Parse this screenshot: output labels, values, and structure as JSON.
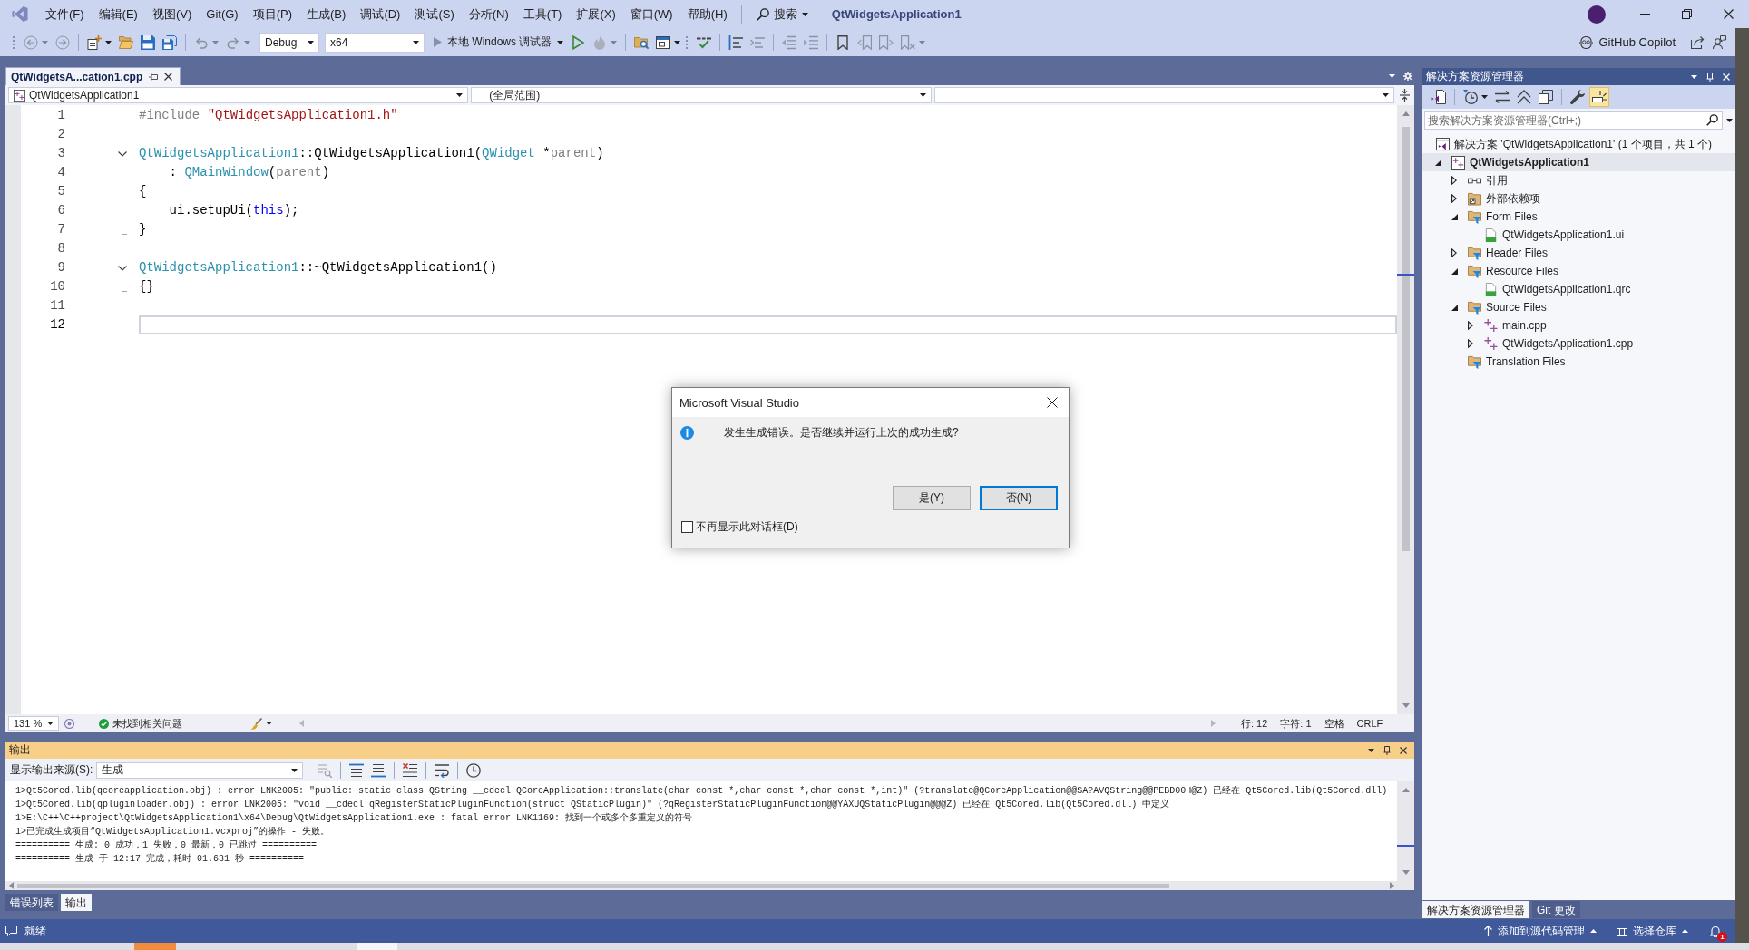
{
  "title_bar": {
    "menu": [
      "文件(F)",
      "编辑(E)",
      "视图(V)",
      "Git(G)",
      "项目(P)",
      "生成(B)",
      "调试(D)",
      "测试(S)",
      "分析(N)",
      "工具(T)",
      "扩展(X)",
      "窗口(W)",
      "帮助(H)"
    ],
    "search": "搜索",
    "title": "QtWidgetsApplication1"
  },
  "toolbar": {
    "left_buttons": [
      {
        "kind": "back",
        "disabled": true
      },
      {
        "kind": "forward",
        "disabled": true
      },
      {
        "kind": "new_item",
        "disabled": false
      },
      {
        "kind": "open",
        "disabled": false
      },
      {
        "kind": "save",
        "disabled": false
      },
      {
        "kind": "save_all",
        "disabled": false
      },
      {
        "kind": "undo",
        "disabled": true
      },
      {
        "kind": "redo",
        "disabled": true
      }
    ],
    "configuration": "Debug",
    "platform": "x64",
    "run_target": "本地 Windows 调试器",
    "right_buttons": [
      {
        "kind": "start",
        "disabled": false
      },
      {
        "kind": "hot_reload",
        "disabled": true
      },
      {
        "kind": "find",
        "disabled": false
      },
      {
        "kind": "layout",
        "disabled": false
      },
      {
        "kind": "spell",
        "disabled": false
      },
      {
        "kind": "comment",
        "disabled": false
      },
      {
        "kind": "uncomment",
        "disabled": true
      },
      {
        "kind": "outdent",
        "disabled": true
      },
      {
        "kind": "indent",
        "disabled": true
      },
      {
        "kind": "bookmark",
        "disabled": false
      },
      {
        "kind": "bookmark_prev",
        "disabled": true
      },
      {
        "kind": "bookmark_next",
        "disabled": true
      },
      {
        "kind": "bookmark_clear",
        "disabled": true
      }
    ],
    "copilot": "GitHub Copilot"
  },
  "editor": {
    "tabs": [
      {
        "label": "QtWidgetsA...cation1.cpp",
        "selected": true
      }
    ],
    "navigation": {
      "project": "QtWidgetsApplication1",
      "scope": "(全局范围)"
    },
    "lines": [
      {
        "number": "1",
        "kind": "plain",
        "current": false,
        "tokens": [
          {
            "kind": "preproc",
            "text": "#include "
          },
          {
            "kind": "string",
            "text": "\"QtWidgetsApplication1.h\""
          }
        ]
      },
      {
        "number": "2",
        "kind": "plain",
        "current": false
      },
      {
        "number": "3",
        "kind": "fold_start",
        "expanded": true,
        "current": false,
        "tokens": [
          {
            "kind": "type",
            "text": "QtWidgetsApplication1"
          },
          {
            "kind": "plain",
            "text": "::QtWidgetsApplication1("
          },
          {
            "kind": "type",
            "text": "QWidget"
          },
          {
            "kind": "plain",
            "text": " *"
          },
          {
            "kind": "param",
            "text": "parent"
          },
          {
            "kind": "plain",
            "text": ")"
          }
        ]
      },
      {
        "number": "4",
        "kind": "fold_body",
        "current": false,
        "tokens": [
          {
            "kind": "plain",
            "text": "    : "
          },
          {
            "kind": "type",
            "text": "QMainWindow"
          },
          {
            "kind": "plain",
            "text": "("
          },
          {
            "kind": "param",
            "text": "parent"
          },
          {
            "kind": "plain",
            "text": ")"
          }
        ]
      },
      {
        "number": "5",
        "kind": "fold_body",
        "current": false,
        "tokens": [
          {
            "kind": "plain",
            "text": "{"
          }
        ]
      },
      {
        "number": "6",
        "kind": "fold_body",
        "current": false,
        "tokens": [
          {
            "kind": "plain",
            "text": "    ui.setupUi("
          },
          {
            "kind": "keyword",
            "text": "this"
          },
          {
            "kind": "plain",
            "text": ");"
          }
        ]
      },
      {
        "number": "7",
        "kind": "fold_end",
        "current": false,
        "tokens": [
          {
            "kind": "plain",
            "text": "}"
          }
        ]
      },
      {
        "number": "8",
        "kind": "plain",
        "current": false
      },
      {
        "number": "9",
        "kind": "fold_start",
        "expanded": true,
        "current": false,
        "tokens": [
          {
            "kind": "type",
            "text": "QtWidgetsApplication1"
          },
          {
            "kind": "plain",
            "text": "::~QtWidgetsApplication1()"
          }
        ]
      },
      {
        "number": "10",
        "kind": "fold_end",
        "current": false,
        "tokens": [
          {
            "kind": "plain",
            "text": "{}"
          }
        ]
      },
      {
        "number": "11",
        "kind": "plain",
        "current": false
      },
      {
        "number": "12",
        "kind": "plain",
        "current": true
      }
    ],
    "status": {
      "zoom": "131 %",
      "issues": "未找到相关问题",
      "line": "行: 12",
      "column": "字符: 1",
      "whitespace": "空格",
      "line_ending": "CRLF"
    }
  },
  "dialog": {
    "title": "Microsoft Visual Studio",
    "message": "发生生成错误。是否继续并运行上次的成功生成?",
    "buttons": [
      {
        "label": "是(Y)",
        "focused": false
      },
      {
        "label": "否(N)",
        "focused": true
      }
    ],
    "checkbox": {
      "label": "不再显示此对话框(D)",
      "checked": false
    }
  },
  "output": {
    "title": "输出",
    "source_label": "显示输出来源(S):",
    "source": "生成",
    "tools": [
      {
        "kind": "find",
        "disabled": true
      },
      {
        "kind": "prev",
        "disabled": false
      },
      {
        "kind": "next",
        "disabled": false
      },
      {
        "kind": "clear",
        "disabled": false
      },
      {
        "kind": "wrap",
        "disabled": false
      },
      {
        "kind": "timestamp",
        "disabled": false
      }
    ],
    "lines": [
      "1>Qt5Cored.lib(qcoreapplication.obj) : error LNK2005: \"public: static class QString __cdecl QCoreApplication::translate(char const *,char const *,char const *,int)\" (?translate@QCoreApplication@@SA?AVQString@@PEBD00H@Z) 已经在 Qt5Cored.lib(Qt5Cored.dll)",
      "1>Qt5Cored.lib(qpluginloader.obj) : error LNK2005: \"void __cdecl qRegisterStaticPluginFunction(struct QStaticPlugin)\" (?qRegisterStaticPluginFunction@@YAXUQStaticPlugin@@@Z) 已经在 Qt5Cored.lib(Qt5Cored.dll) 中定义",
      "1>E:\\C++\\C++project\\QtWidgetsApplication1\\x64\\Debug\\QtWidgetsApplication1.exe : fatal error LNK1169: 找到一个或多个多重定义的符号",
      "1>已完成生成项目“QtWidgetsApplication1.vcxproj”的操作 - 失败。",
      "========== 生成: 0 成功，1 失败，0 最新，0 已跳过 ==========",
      "========== 生成 于 12:17 完成，耗时 01.631 秒 =========="
    ]
  },
  "bottom_tabs": [
    {
      "label": "错误列表",
      "selected": false
    },
    {
      "label": "输出",
      "selected": true
    }
  ],
  "solution_explorer": {
    "title": "解决方案资源管理器",
    "tools": [
      {
        "kind": "switch_views",
        "on": false
      },
      {
        "kind": "pending_changes",
        "on": false
      },
      {
        "kind": "sync",
        "on": false
      },
      {
        "kind": "collapse_all",
        "on": false
      },
      {
        "kind": "show_all",
        "on": false
      },
      {
        "kind": "properties",
        "on": false
      },
      {
        "kind": "preview",
        "on": true
      }
    ],
    "search": {
      "placeholder": "搜索解决方案资源管理器(Ctrl+;)"
    },
    "tree": [
      {
        "label": "解决方案 'QtWidgetsApplication1' (1 个项目，共 1 个)",
        "kind": "solution",
        "selected": false,
        "children": [
          {
            "label": "QtWidgetsApplication1",
            "kind": "project",
            "expanded": true,
            "selected": true,
            "children": [
              {
                "label": "引用",
                "kind": "references",
                "expanded": false,
                "selected": false
              },
              {
                "label": "外部依赖项",
                "kind": "external",
                "expanded": false,
                "selected": false
              },
              {
                "label": "Form Files",
                "kind": "filter",
                "expanded": true,
                "selected": false,
                "children": [
                  {
                    "label": "QtWidgetsApplication1.ui",
                    "kind": "ui",
                    "selected": false
                  }
                ]
              },
              {
                "label": "Header Files",
                "kind": "filter",
                "expanded": false,
                "selected": false
              },
              {
                "label": "Resource Files",
                "kind": "filter",
                "expanded": true,
                "selected": false,
                "children": [
                  {
                    "label": "QtWidgetsApplication1.qrc",
                    "kind": "qrc",
                    "selected": false
                  }
                ]
              },
              {
                "label": "Source Files",
                "kind": "filter",
                "expanded": true,
                "selected": false,
                "children": [
                  {
                    "label": "main.cpp",
                    "kind": "cpp",
                    "expanded": false,
                    "selected": false
                  },
                  {
                    "label": "QtWidgetsApplication1.cpp",
                    "kind": "cpp",
                    "expanded": false,
                    "selected": false
                  }
                ]
              },
              {
                "label": "Translation Files",
                "kind": "filter",
                "selected": false
              }
            ]
          }
        ]
      }
    ],
    "tabs": [
      {
        "label": "解决方案资源管理器",
        "selected": true
      },
      {
        "label": "Git 更改",
        "selected": false
      }
    ]
  },
  "status_bar": {
    "message": "就绪",
    "source_control": "添加到源代码管理",
    "repository": "选择仓库",
    "notifications": "1"
  }
}
